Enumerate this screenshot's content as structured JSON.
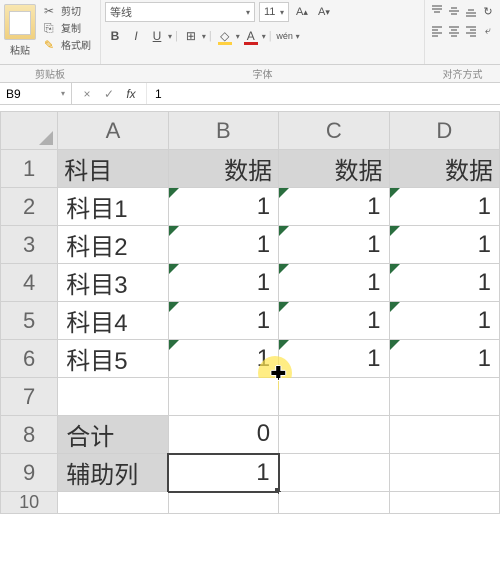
{
  "toolbar": {
    "paste_label": "粘贴",
    "cut_label": "剪切",
    "copy_label": "复制",
    "brush_label": "格式刷",
    "font_name": "等线",
    "font_size": "11",
    "bold": "B",
    "italic": "I",
    "underline": "U",
    "wen": "wén",
    "group_clipboard": "剪贴板",
    "group_font": "字体",
    "group_align": "对齐方式"
  },
  "formula_bar": {
    "name_box": "B9",
    "cancel": "×",
    "confirm": "✓",
    "fx": "fx",
    "value": "1"
  },
  "grid": {
    "col_headers": [
      "A",
      "B",
      "C",
      "D"
    ],
    "row_headers": [
      "1",
      "2",
      "3",
      "4",
      "5",
      "6",
      "7",
      "8",
      "9",
      "10"
    ],
    "header_row": [
      "科目",
      "数据",
      "数据",
      "数据"
    ],
    "rows": [
      [
        "科目1",
        "1",
        "1",
        "1"
      ],
      [
        "科目2",
        "1",
        "1",
        "1"
      ],
      [
        "科目3",
        "1",
        "1",
        "1"
      ],
      [
        "科目4",
        "1",
        "1",
        "1"
      ],
      [
        "科目5",
        "1",
        "1",
        "1"
      ]
    ],
    "sum_label": "合计",
    "sum_value": "0",
    "aux_label": "辅助列",
    "aux_value": "1"
  },
  "chart_data": {
    "type": "table",
    "columns": [
      "科目",
      "数据",
      "数据",
      "数据"
    ],
    "rows": [
      [
        "科目1",
        1,
        1,
        1
      ],
      [
        "科目2",
        1,
        1,
        1
      ],
      [
        "科目3",
        1,
        1,
        1
      ],
      [
        "科目4",
        1,
        1,
        1
      ],
      [
        "科目5",
        1,
        1,
        1
      ]
    ],
    "summary": {
      "合计": 0,
      "辅助列": 1
    }
  }
}
